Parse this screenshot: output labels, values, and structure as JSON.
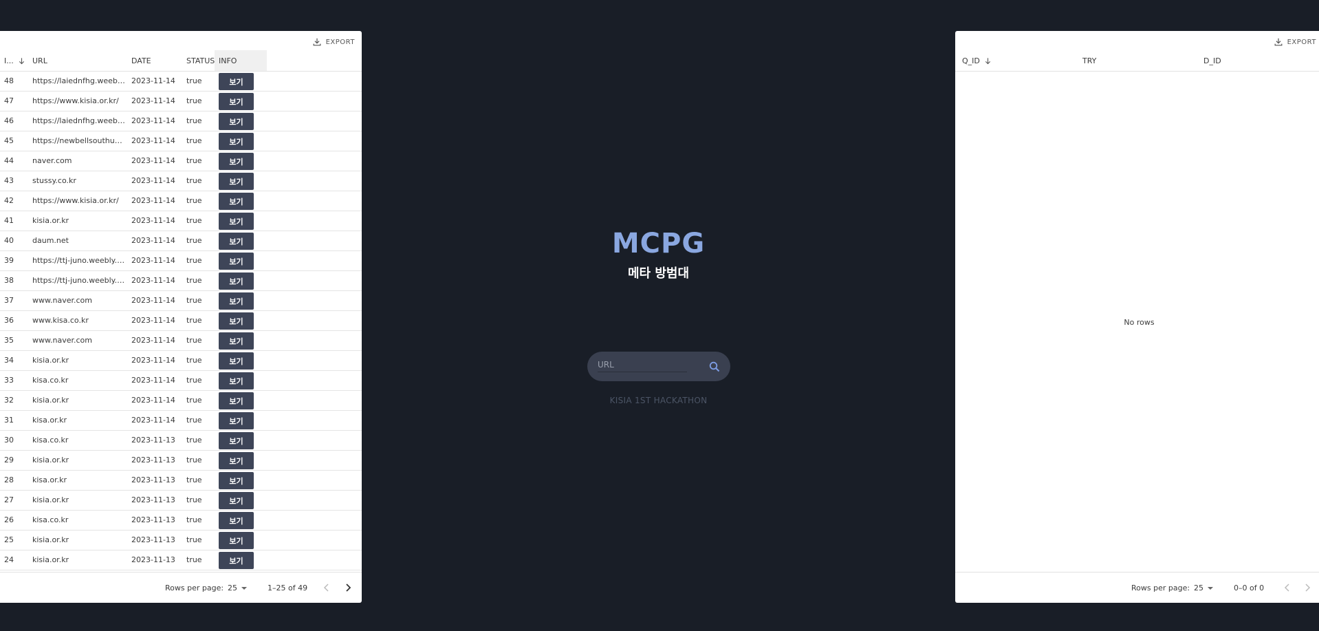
{
  "colors": {
    "background": "#191e27",
    "accent": "#8aa7e0",
    "button": "#3e4558",
    "search_bg": "#3a4050"
  },
  "center": {
    "title": "MCPG",
    "subtitle": "메타 방범대",
    "search_placeholder": "URL",
    "footer_text": "KISIA 1ST HACKATHON"
  },
  "left_grid": {
    "export_label": "EXPORT",
    "columns": [
      "I...",
      "URL",
      "DATE",
      "STATUS",
      "INFO"
    ],
    "view_label": "보기",
    "rows": [
      {
        "id": "48",
        "url": "https://laiednfhg.weebl...",
        "date": "2023-11-14",
        "status": "true"
      },
      {
        "id": "47",
        "url": "https://www.kisia.or.kr/",
        "date": "2023-11-14",
        "status": "true"
      },
      {
        "id": "46",
        "url": "https://laiednfhg.weebl...",
        "date": "2023-11-14",
        "status": "true"
      },
      {
        "id": "45",
        "url": "https://newbellsouthup...",
        "date": "2023-11-14",
        "status": "true"
      },
      {
        "id": "44",
        "url": "naver.com",
        "date": "2023-11-14",
        "status": "true"
      },
      {
        "id": "43",
        "url": "stussy.co.kr",
        "date": "2023-11-14",
        "status": "true"
      },
      {
        "id": "42",
        "url": "https://www.kisia.or.kr/",
        "date": "2023-11-14",
        "status": "true"
      },
      {
        "id": "41",
        "url": "kisia.or.kr",
        "date": "2023-11-14",
        "status": "true"
      },
      {
        "id": "40",
        "url": "daum.net",
        "date": "2023-11-14",
        "status": "true"
      },
      {
        "id": "39",
        "url": "https://ttj-juno.weebly.c...",
        "date": "2023-11-14",
        "status": "true"
      },
      {
        "id": "38",
        "url": "https://ttj-juno.weebly.c...",
        "date": "2023-11-14",
        "status": "true"
      },
      {
        "id": "37",
        "url": "www.naver.com",
        "date": "2023-11-14",
        "status": "true"
      },
      {
        "id": "36",
        "url": "www.kisa.co.kr",
        "date": "2023-11-14",
        "status": "true"
      },
      {
        "id": "35",
        "url": "www.naver.com",
        "date": "2023-11-14",
        "status": "true"
      },
      {
        "id": "34",
        "url": "kisia.or.kr",
        "date": "2023-11-14",
        "status": "true"
      },
      {
        "id": "33",
        "url": "kisa.co.kr",
        "date": "2023-11-14",
        "status": "true"
      },
      {
        "id": "32",
        "url": "kisia.or.kr",
        "date": "2023-11-14",
        "status": "true"
      },
      {
        "id": "31",
        "url": "kisa.or.kr",
        "date": "2023-11-14",
        "status": "true"
      },
      {
        "id": "30",
        "url": "kisa.co.kr",
        "date": "2023-11-13",
        "status": "true"
      },
      {
        "id": "29",
        "url": "kisia.or.kr",
        "date": "2023-11-13",
        "status": "true"
      },
      {
        "id": "28",
        "url": "kisa.or.kr",
        "date": "2023-11-13",
        "status": "true"
      },
      {
        "id": "27",
        "url": "kisia.or.kr",
        "date": "2023-11-13",
        "status": "true"
      },
      {
        "id": "26",
        "url": "kisa.co.kr",
        "date": "2023-11-13",
        "status": "true"
      },
      {
        "id": "25",
        "url": "kisia.or.kr",
        "date": "2023-11-13",
        "status": "true"
      },
      {
        "id": "24",
        "url": "kisia.or.kr",
        "date": "2023-11-13",
        "status": "true"
      }
    ],
    "footer": {
      "rows_per_page_label": "Rows per page:",
      "rows_per_page": "25",
      "range": "1–25 of 49"
    }
  },
  "right_grid": {
    "export_label": "EXPORT",
    "columns": [
      "Q_ID",
      "TRY",
      "D_ID"
    ],
    "empty_text": "No rows",
    "footer": {
      "rows_per_page_label": "Rows per page:",
      "rows_per_page": "25",
      "range": "0–0 of 0"
    }
  }
}
